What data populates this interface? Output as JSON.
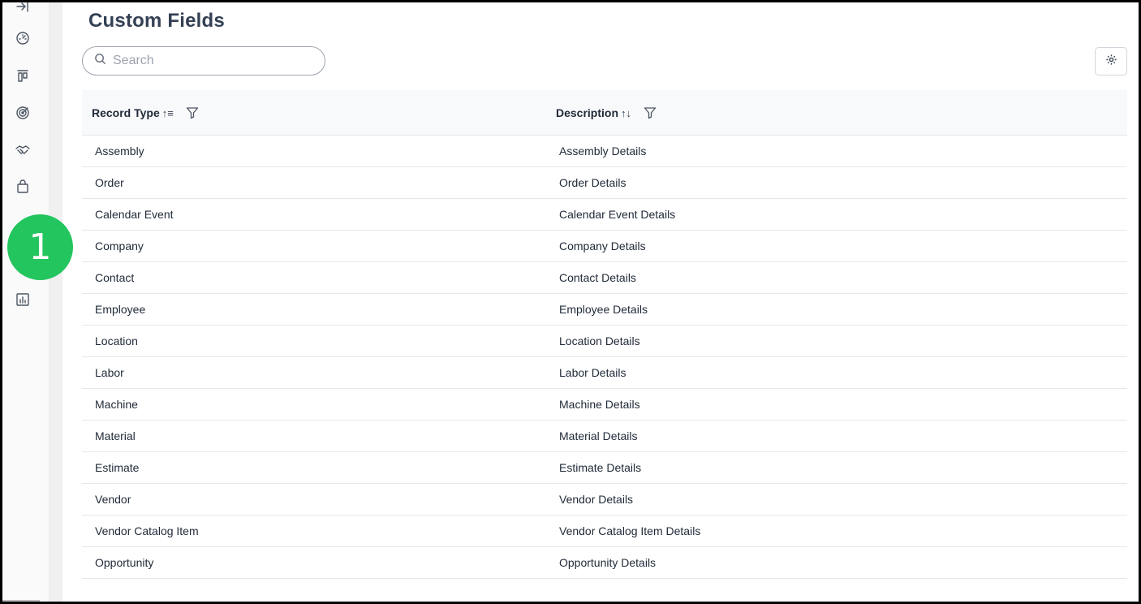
{
  "sidebar": {
    "items": [
      {
        "icon": "collapse-arrow-icon"
      },
      {
        "icon": "dashboard-gauge-icon"
      },
      {
        "icon": "board-columns-icon"
      },
      {
        "icon": "target-icon"
      },
      {
        "icon": "handshake-icon"
      },
      {
        "icon": "shopping-bag-icon"
      },
      {
        "icon": "report-chart-icon"
      }
    ],
    "badge_number": "1",
    "badge_color": "#23c55e"
  },
  "header": {
    "title": "Custom Fields"
  },
  "search": {
    "placeholder": "Search"
  },
  "table": {
    "columns": [
      {
        "label": "Record Type",
        "sort_glyph": "↑≡"
      },
      {
        "label": "Description",
        "sort_glyph": "↑↓"
      }
    ],
    "rows": [
      {
        "record_type": "Assembly",
        "description": "Assembly Details"
      },
      {
        "record_type": "Order",
        "description": "Order Details"
      },
      {
        "record_type": "Calendar Event",
        "description": "Calendar Event Details"
      },
      {
        "record_type": "Company",
        "description": "Company Details"
      },
      {
        "record_type": "Contact",
        "description": "Contact Details"
      },
      {
        "record_type": "Employee",
        "description": "Employee Details"
      },
      {
        "record_type": "Location",
        "description": "Location Details"
      },
      {
        "record_type": "Labor",
        "description": "Labor Details"
      },
      {
        "record_type": "Machine",
        "description": "Machine Details"
      },
      {
        "record_type": "Material",
        "description": "Material Details"
      },
      {
        "record_type": "Estimate",
        "description": "Estimate Details"
      },
      {
        "record_type": "Vendor",
        "description": "Vendor Details"
      },
      {
        "record_type": "Vendor Catalog Item",
        "description": "Vendor Catalog Item Details"
      },
      {
        "record_type": "Opportunity",
        "description": "Opportunity Details"
      }
    ]
  }
}
